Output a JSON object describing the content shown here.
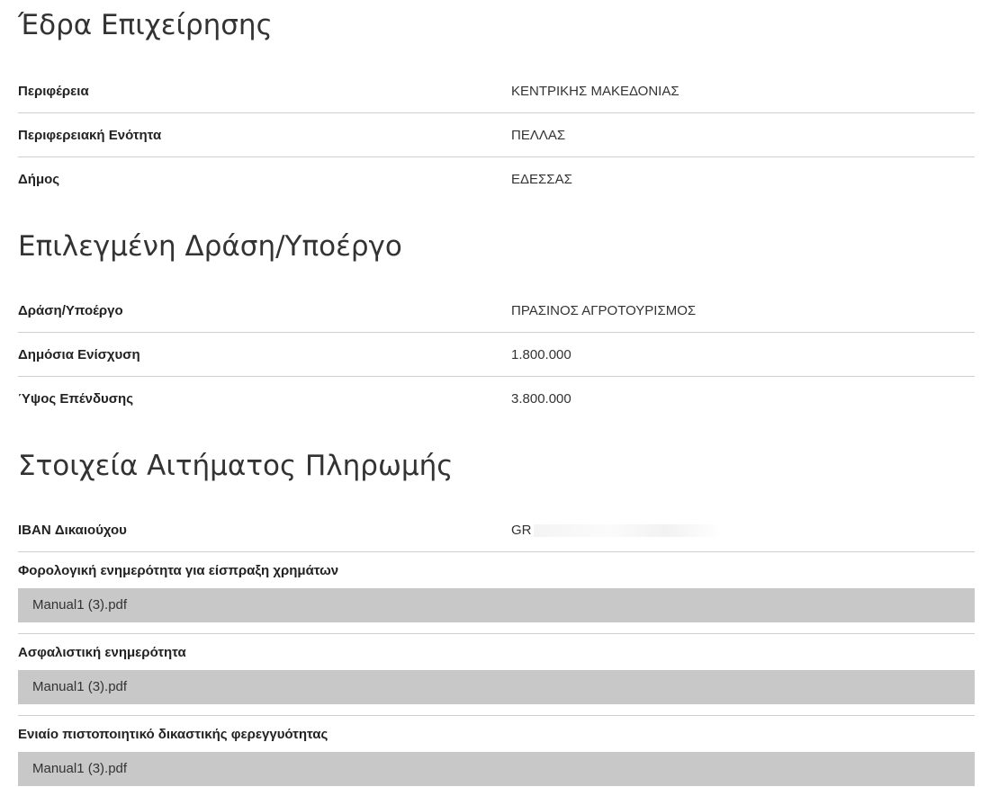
{
  "seat": {
    "title": "Έδρα Επιχείρησης",
    "rows": [
      {
        "label": "Περιφέρεια",
        "value": "ΚΕΝΤΡΙΚΗΣ ΜΑΚΕΔΟΝΙΑΣ"
      },
      {
        "label": "Περιφερειακή Ενότητα",
        "value": "ΠΕΛΛΑΣ"
      },
      {
        "label": "Δήμος",
        "value": "ΕΔΕΣΣΑΣ"
      }
    ]
  },
  "action": {
    "title": "Επιλεγμένη Δράση/Υποέργο",
    "rows": [
      {
        "label": "Δράση/Υποέργο",
        "value": "ΠΡΑΣΙΝΟΣ ΑΓΡΟΤΟΥΡΙΣΜΟΣ"
      },
      {
        "label": "Δημόσια Ενίσχυση",
        "value": "1.800.000"
      },
      {
        "label": "Ύψος Επένδυσης",
        "value": "3.800.000"
      }
    ]
  },
  "payment": {
    "title": "Στοιχεία Αιτήματος Πληρωμής",
    "iban_label": "IBAN Δικαιούχου",
    "iban_value": "GR",
    "files": [
      {
        "label": "Φορολογική ενημερότητα για είσπραξη χρημάτων",
        "filename": "Manual1 (3).pdf"
      },
      {
        "label": "Ασφαλιστική ενημερότητα",
        "filename": "Manual1 (3).pdf"
      },
      {
        "label": "Ενιαίο πιστοποιητικό δικαστικής φερεγγυότητας",
        "filename": "Manual1 (3).pdf"
      }
    ]
  }
}
